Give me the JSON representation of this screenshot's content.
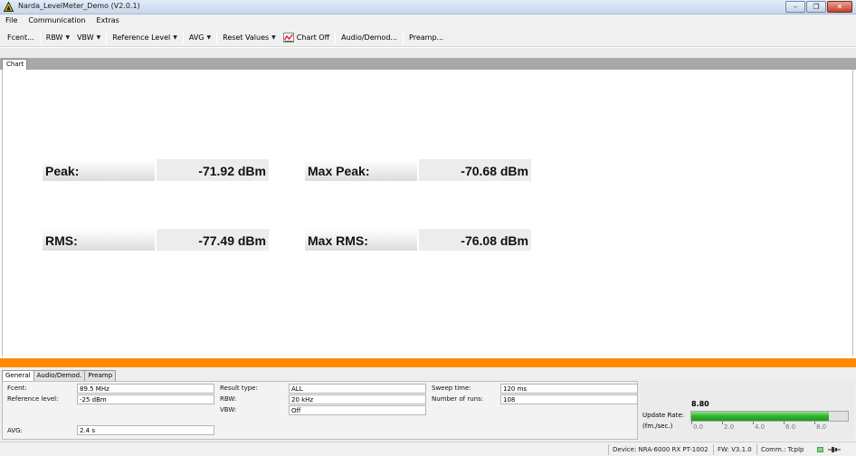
{
  "window": {
    "title": "Narda_LevelMeter_Demo (V2.0.1)",
    "minimize_glyph": "–",
    "restore_glyph": "❐",
    "close_glyph": "✕"
  },
  "menu": {
    "items": [
      "File",
      "Communication",
      "Extras"
    ]
  },
  "toolbar": {
    "fcent": "Fcent...",
    "rbw": "RBW",
    "vbw": "VBW",
    "reference_level": "Reference Level",
    "avg": "AVG",
    "reset_values": "Reset Values",
    "chart_off": "Chart Off",
    "audio_demod": "Audio/Demod...",
    "preamp": "Preamp...",
    "caret": "▼"
  },
  "tabs": {
    "chart": "Chart"
  },
  "measurements": {
    "peak_label": "Peak:",
    "peak_value": "-71.92 dBm",
    "max_peak_label": "Max Peak:",
    "max_peak_value": "-70.68 dBm",
    "rms_label": "RMS:",
    "rms_value": "-77.49 dBm",
    "max_rms_label": "Max RMS:",
    "max_rms_value": "-76.08 dBm"
  },
  "bottom_tabs": [
    "General",
    "Audio/Demod.",
    "Preamp"
  ],
  "general": {
    "fcent_label": "Fcent:",
    "fcent_value": "89.5 MHz",
    "ref_level_label": "Reference level:",
    "ref_level_value": "-25 dBm",
    "avg_label": "AVG:",
    "avg_value": "2.4 s",
    "result_type_label": "Result type:",
    "result_type_value": "ALL",
    "rbw_label": "RBW:",
    "rbw_value": "20 kHz",
    "vbw_label": "VBW:",
    "vbw_value": "Off",
    "sweep_time_label": "Sweep time:",
    "sweep_time_value": "120 ms",
    "number_of_runs_label": "Number of runs:",
    "number_of_runs_value": "108"
  },
  "update_rate": {
    "value_text": "8.80",
    "label": "Update Rate:",
    "unit": "(fm./sec.)",
    "value": 8.8,
    "max": 10,
    "ticks": [
      "0.0",
      "2.0",
      "4.0",
      "6.0",
      "8.0"
    ]
  },
  "status": {
    "device": "Device: NRA-6000 RX PT-1002",
    "fw": "FW: V3.1.0",
    "comm": "Comm.: TcpIp"
  },
  "colors": {
    "accent_orange": "#ff8a00",
    "progress_green": "#2bb52b",
    "tab_row_gray": "#a8a8a8"
  }
}
